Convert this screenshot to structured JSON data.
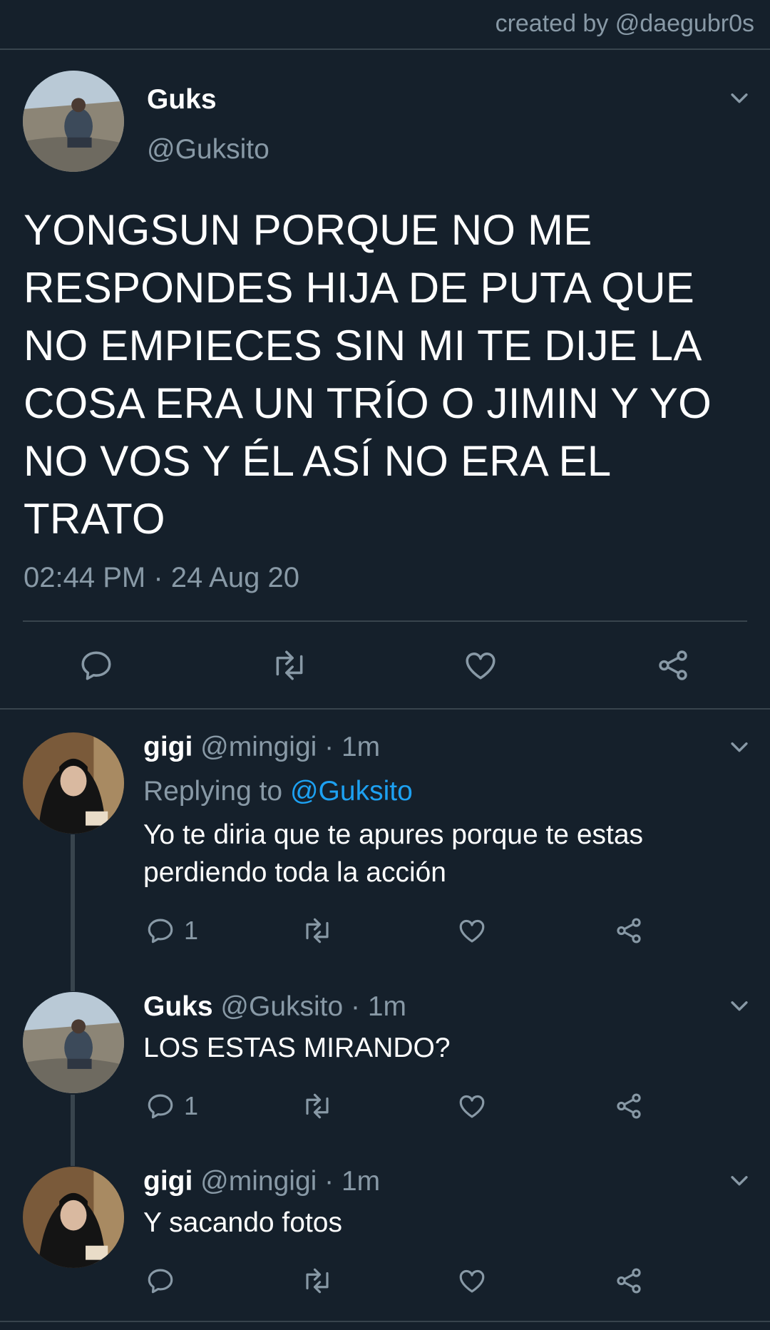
{
  "credit": "created by @daegubr0s",
  "main_tweet": {
    "name": "Guks",
    "handle": "@Guksito",
    "text": "YONGSUN PORQUE NO ME RESPONDES HIJA DE PUTA QUE NO EMPIECES SIN MI TE DIJE LA COSA ERA UN TRÍO O JIMIN Y YO NO VOS Y ÉL ASÍ NO ERA EL TRATO",
    "timestamp": "02:44 PM · 24 Aug 20"
  },
  "replies": [
    {
      "name": "gigi",
      "meta": "@mingigi · 1m",
      "replying_prefix": "Replying to ",
      "replying_handle": "@Guksito",
      "text": "Yo te diria que te apures porque te estas perdiendo toda la acción",
      "reply_count": "1"
    },
    {
      "name": "Guks",
      "meta": "@Guksito · 1m",
      "text": "LOS ESTAS MIRANDO?",
      "reply_count": "1"
    },
    {
      "name": "gigi",
      "meta": "@mingigi · 1m",
      "text": "Y sacando fotos"
    }
  ],
  "icons": {
    "reply": "reply-icon",
    "retweet": "retweet-icon",
    "like": "heart-icon",
    "share": "share-icon",
    "more": "chevron-down-icon"
  },
  "colors": {
    "background": "#15202b",
    "secondary_text": "#8899a6",
    "link": "#1da1f2",
    "divider": "#38444d"
  }
}
